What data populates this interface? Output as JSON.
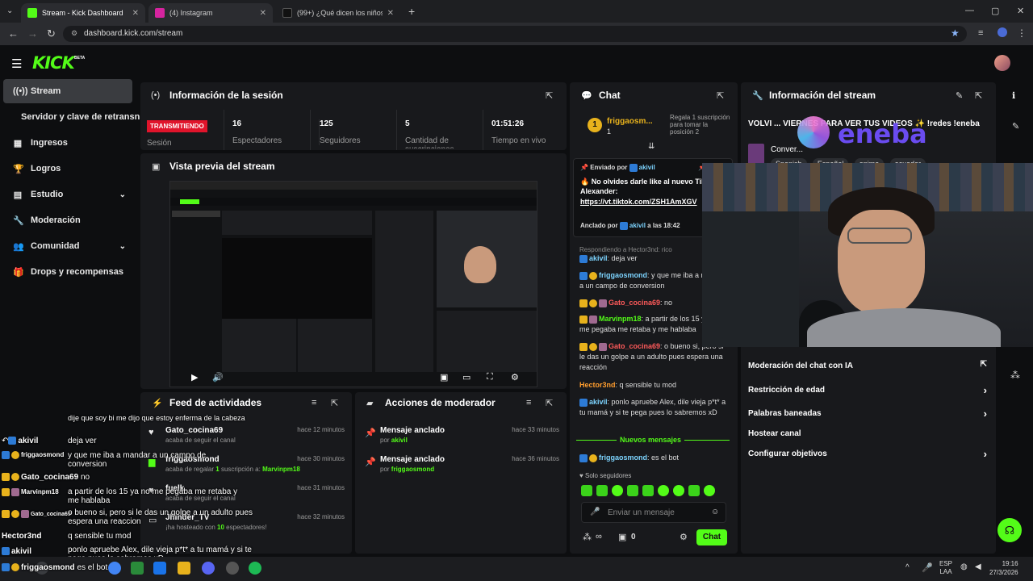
{
  "browser": {
    "tabs": [
      {
        "title": "Stream - Kick Dashboard",
        "color": "#53fc18"
      },
      {
        "title": "(4) Instagram",
        "color": "#d6249f"
      },
      {
        "title": "(99+) ¿Qué dicen los niños hoy",
        "color": "#111111"
      }
    ],
    "url": "dashboard.kick.com/stream"
  },
  "header": {
    "logo": "KICK",
    "beta": "BETA"
  },
  "sidebar": {
    "items": [
      {
        "label": "Stream",
        "icon": "broadcast-icon"
      },
      {
        "label": "Servidor y clave de retransn",
        "icon": ""
      },
      {
        "label": "Ingresos",
        "icon": "chart-icon"
      },
      {
        "label": "Logros",
        "icon": "trophy-icon"
      },
      {
        "label": "Estudio",
        "icon": "studio-icon"
      },
      {
        "label": "Moderación",
        "icon": "wrench-icon"
      },
      {
        "label": "Comunidad",
        "icon": "people-icon"
      },
      {
        "label": "Drops y recompensas",
        "icon": "gift-icon"
      }
    ]
  },
  "session": {
    "title": "Información de la sesión",
    "live": "TRANSMITIENDO",
    "live_label": "Sesión",
    "stats": [
      {
        "value": "16",
        "label": "Espectadores"
      },
      {
        "value": "125",
        "label": "Seguidores"
      },
      {
        "value": "5",
        "label": "Cantidad de suscripciones"
      },
      {
        "value": "01:51:26",
        "label": "Tiempo en vivo"
      }
    ]
  },
  "preview": {
    "title": "Vista previa del stream"
  },
  "feed": {
    "title": "Feed de actividades",
    "rows": [
      {
        "who": "Gato_cocina69",
        "sub": "acaba de seguir el canal",
        "when": "hace 12 minutos"
      },
      {
        "who": "friggaosmond",
        "sub_pre": "acaba de regalar ",
        "sub_num": "1",
        "sub_mid": " suscripción a: ",
        "sub_user": "Marvinpm18",
        "when": "hace 30 minutos"
      },
      {
        "who": "fuelk",
        "sub": "acaba de seguir el canal",
        "when": "hace 31 minutos"
      },
      {
        "who": "Jhinder_TV",
        "sub_pre": "¡ha hosteado con ",
        "sub_num": "10",
        "sub_mid": " espectadores!",
        "when": "hace 32 minutos"
      }
    ]
  },
  "mod": {
    "title": "Acciones de moderador",
    "rows": [
      {
        "who": "Mensaje anclado",
        "by": "por ",
        "user": "akivil",
        "when": "hace 33 minutos"
      },
      {
        "who": "Mensaje anclado",
        "by": "por ",
        "user": "friggaosmond",
        "when": "hace 36 minutos"
      }
    ]
  },
  "chat": {
    "title": "Chat",
    "top_gifter": "friggaosm...",
    "top_gifter_count": "1",
    "gift_prompt": "Regala 1 suscripción para tomar la posición 2",
    "pinned": {
      "by_label": "Enviado por",
      "by_user": "akivil",
      "text": "No olvides darle like al nuevo Tiktok de Alexander:",
      "link": "https://vt.tiktok.com/ZSH1AmXGV",
      "anchored_label": "Anclado por",
      "anchored_user": "akivil",
      "anchored_time": "a las 18:42"
    },
    "reply_to": "Respondiendo a Hector3nd: rico",
    "messages": [
      {
        "user": "akivil",
        "cls": "u-blue",
        "text": ": deja ver"
      },
      {
        "user": "friggaosmond",
        "cls": "u-blue",
        "text": ": y que me iba a mandar a un campo de conversion"
      },
      {
        "user": "Gato_cocina69",
        "cls": "u-red",
        "text": ": no"
      },
      {
        "user": "Marvinpm18",
        "cls": "u-green",
        "text": ": a partir de los 15 y no me pegaba me retaba y me hablaba"
      },
      {
        "user": "Gato_cocina69",
        "cls": "u-red",
        "text": ": o bueno si, pero si le das un golpe a un adulto pues espera una reacción"
      },
      {
        "user": "Hector3nd",
        "cls": "u-orange",
        "text": ": q sensible tu mod"
      },
      {
        "user": "akivil",
        "cls": "u-blue",
        "text": ": ponlo apruebe Alex, dile vieja p*t* a tu mamá y si te pega pues lo sabremos xD"
      }
    ],
    "new_messages": "Nuevos mensajes",
    "last_user": "friggaosmond",
    "last_text": ": es el bot",
    "followers_only": "Solo seguidores",
    "input_placeholder": "Enviar un mensaje",
    "points": "0",
    "send": "Chat"
  },
  "stream_info": {
    "title": "Información del stream",
    "stream_title": "VOLVI ... VIERNES PARA VER TUS VIDEOS ✨ !redes !eneba",
    "category": "Conver...",
    "tags": [
      "Spanish",
      "Español",
      "anime",
      "ecuador"
    ],
    "rows": [
      {
        "label": "Moderación del chat con IA",
        "arrow": "⇱"
      },
      {
        "label": "Restricción de edad",
        "arrow": "›"
      },
      {
        "label": "Palabras baneadas",
        "arrow": "›"
      },
      {
        "label": "Hostear canal",
        "arrow": ""
      },
      {
        "label": "Configurar objetivos",
        "arrow": "›"
      }
    ]
  },
  "overlay": {
    "brand": "eneba",
    "chat": [
      {
        "user": "",
        "text": "dije que soy bi me dijo que estoy enferma de la cabeza"
      },
      {
        "user": "akivil",
        "text": "deja ver"
      },
      {
        "user": "friggaosmond",
        "text": "y que me iba a mandar a un campo de conversion"
      },
      {
        "user": "Gato_cocina69",
        "text": "no"
      },
      {
        "user": "Marvinpm18",
        "text": "a partir de los 15 ya no me pegaba me retaba y me hablaba"
      },
      {
        "user": "Gato_cocina69",
        "text": "o bueno si, pero si le das un golpe a un adulto pues espera una reaccion"
      },
      {
        "user": "Hector3nd",
        "text": "q sensible tu mod"
      },
      {
        "user": "akivil",
        "text": "ponlo apruebe Alex, dile vieja p*t* a tu mamá y si te pega pues lo sabremos xD"
      },
      {
        "user": "friggaosmond",
        "text": "es el bot"
      }
    ]
  },
  "taskbar": {
    "lang": "ESP",
    "region": "LAA",
    "time": "19:16",
    "date": "27/3/2026"
  }
}
